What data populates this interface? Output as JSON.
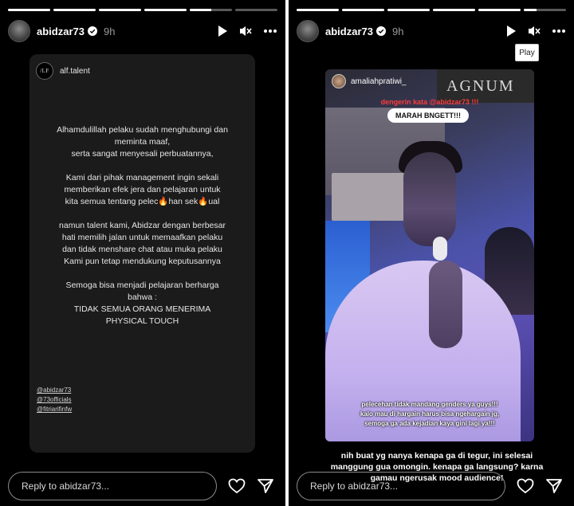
{
  "left_story": {
    "progress": [
      1,
      1,
      1,
      1,
      0.5,
      0
    ],
    "header": {
      "username": "abidzar73",
      "time": "9h"
    },
    "shared_card": {
      "account": "alf.talent",
      "logo_text": "/LF",
      "paragraphs": [
        [
          "Alhamdulillah pelaku sudah menghubungi dan",
          "meminta maaf,",
          "serta sangat menyesali perbuatannya,"
        ],
        [
          "Kami dari pihak management ingin sekali",
          "memberikan efek jera dan pelajaran untuk",
          "kita semua tentang pelec🔥han sek🔥ual"
        ],
        [
          "namun talent kami, Abidzar dengan berbesar",
          "hati memilih jalan untuk memaafkan pelaku",
          "dan tidak menshare chat atau muka pelaku",
          "Kami pun tetap mendukung keputusannya"
        ],
        [
          "Semoga bisa menjadi pelajaran berharga",
          "bahwa :",
          "TIDAK SEMUA ORANG MENERIMA",
          "PHYSICAL TOUCH"
        ]
      ],
      "mentions": [
        "@abidzar73",
        "@73officials",
        "@fitriarifinfw"
      ]
    },
    "reply_placeholder": "Reply to abidzar73..."
  },
  "right_story": {
    "progress": [
      1,
      1,
      1,
      1,
      1,
      0.3
    ],
    "header": {
      "username": "abidzar73",
      "time": "9h"
    },
    "tooltip": "Play",
    "video": {
      "account": "amaliahpratiwi_",
      "sign_text": "AGNUM",
      "red_text": "dengerin kata @abidzar73 !!!",
      "pill_text": "MARAH BNGETT!!!",
      "bottom_caption": [
        "pelecehan tidak mandang genders ya guys!!!",
        "kalo mau di hargain harus bisa ngehargain jg,",
        "semoga ga ada kejadian kaya gini lagi ya!!!"
      ]
    },
    "outside_caption": [
      "nih buat yg nanya kenapa ga di tegur, ini selesai",
      "manggung gua omongin. kenapa ga langsung? karna",
      "gamau ngerusak mood audience!"
    ],
    "reply_placeholder": "Reply to abidzar73..."
  },
  "colors": {
    "background": "#000000",
    "card": "#1b1b1b",
    "verified": "#ffffff",
    "red_text": "#ff3b3b"
  },
  "icons": [
    "verified-badge-icon",
    "play-icon",
    "mute-icon",
    "more-icon",
    "heart-icon",
    "send-icon"
  ]
}
